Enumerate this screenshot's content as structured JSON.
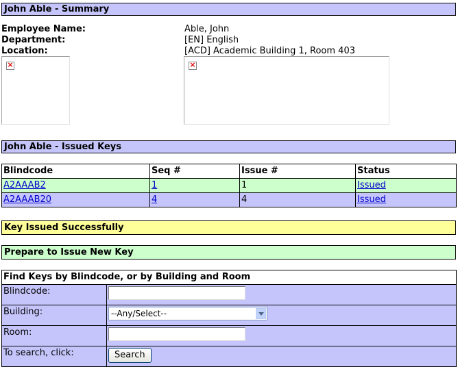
{
  "summary": {
    "title": "John Able - Summary",
    "employee_name_label": "Employee Name:",
    "employee_name_value": "Able, John",
    "department_label": "Department:",
    "department_value": "[EN] English",
    "location_label": "Location:",
    "location_value": "[ACD] Academic Building 1, Room 403"
  },
  "issued_keys": {
    "title": "John Able - Issued Keys",
    "columns": [
      "Blindcode",
      "Seq #",
      "Issue #",
      "Status"
    ],
    "rows": [
      {
        "blindcode": "A2AAAB2",
        "seq": "1",
        "issue": "1",
        "status": "Issued"
      },
      {
        "blindcode": "A2AAAB20",
        "seq": "4",
        "issue": "4",
        "status": "Issued"
      }
    ]
  },
  "messages": {
    "success": "Key Issued Successfully",
    "prepare": "Prepare to Issue New Key"
  },
  "find": {
    "title": "Find Keys by Blindcode, or by Building and Room",
    "blindcode_label": "Blindcode:",
    "blindcode_value": "",
    "building_label": "Building:",
    "building_selected": "--Any/Select--",
    "room_label": "Room:",
    "room_value": "",
    "search_label": "To search, click:",
    "search_button": "Search"
  },
  "colors": {
    "header_purple": "#c5c5fb",
    "success_yellow": "#ffff99",
    "row_green": "#ccffcc",
    "link_blue": "#0000cc"
  },
  "icons": [
    "broken-image-icon",
    "dropdown-arrow-icon"
  ]
}
